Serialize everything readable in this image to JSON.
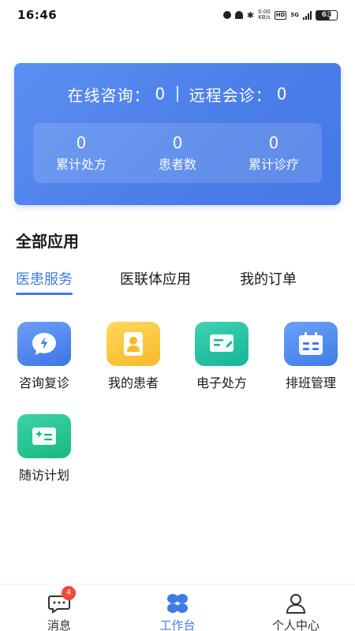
{
  "status_bar": {
    "time": "16:46",
    "network_speed": "0.00\nKB/s",
    "hd": "HD",
    "signal": "5G",
    "battery": "63"
  },
  "consult_card": {
    "online_label": "在线咨询：",
    "online_value": "0",
    "remote_label": "远程会诊：",
    "remote_value": "0",
    "stats": [
      {
        "value": "0",
        "label": "累计处方"
      },
      {
        "value": "0",
        "label": "患者数"
      },
      {
        "value": "0",
        "label": "累计诊疗"
      }
    ]
  },
  "section_title": "全部应用",
  "tabs": [
    {
      "label": "医患服务",
      "active": true
    },
    {
      "label": "医联体应用",
      "active": false
    },
    {
      "label": "我的订单",
      "active": false
    }
  ],
  "apps": [
    {
      "label": "咨询复诊",
      "icon": "consult-icon",
      "color": "#4a80ea"
    },
    {
      "label": "我的患者",
      "icon": "patient-icon",
      "color": "#f9c33a"
    },
    {
      "label": "电子处方",
      "icon": "prescription-icon",
      "color": "#1fbf9e"
    },
    {
      "label": "排班管理",
      "icon": "calendar-icon",
      "color": "#4a84ec"
    },
    {
      "label": "随访计划",
      "icon": "followup-icon",
      "color": "#20c08d"
    }
  ],
  "bottom_nav": {
    "items": [
      {
        "label": "消息",
        "icon": "message-icon",
        "badge": "4",
        "active": false
      },
      {
        "label": "工作台",
        "icon": "workbench-icon",
        "active": true
      },
      {
        "label": "个人中心",
        "icon": "profile-icon",
        "active": false
      }
    ]
  },
  "colors": {
    "accent": "#3f7be8",
    "badge": "#f04a3b"
  }
}
